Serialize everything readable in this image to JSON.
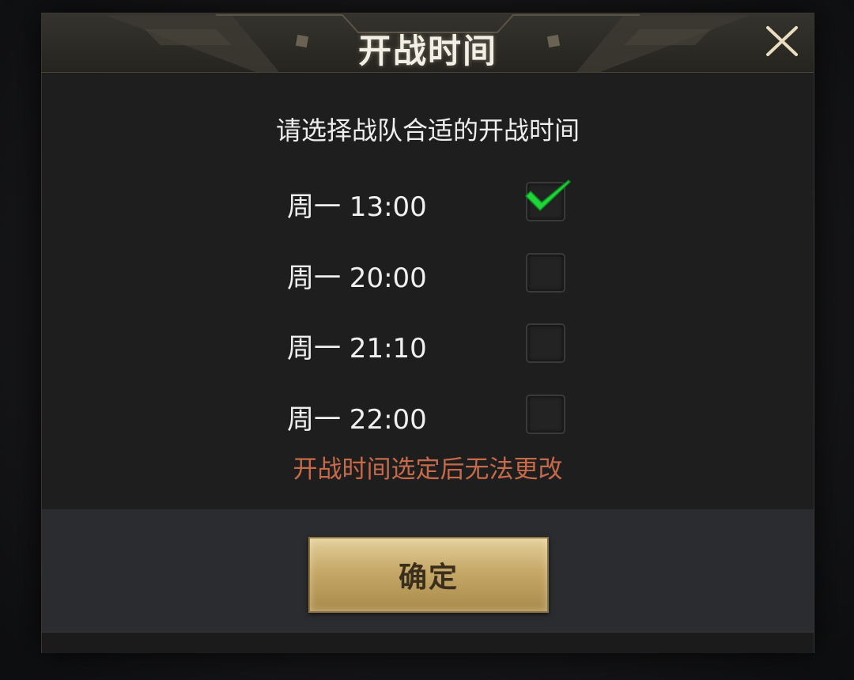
{
  "dialog": {
    "title": "开战时间",
    "subtitle": "请选择战队合适的开战时间",
    "slots": [
      {
        "label": "周一 13:00",
        "checked": true
      },
      {
        "label": "周一 20:00",
        "checked": false
      },
      {
        "label": "周一 21:10",
        "checked": false
      },
      {
        "label": "周一 22:00",
        "checked": false
      }
    ],
    "warning": "开战时间选定后无法更改",
    "confirm_label": "确定"
  },
  "icons": {
    "close": "close-icon",
    "check": "checkmark-icon"
  },
  "colors": {
    "title": "#f2efe6",
    "warning": "#c66a4a",
    "check": "#22d33a",
    "button_gold": "#c6a868"
  }
}
